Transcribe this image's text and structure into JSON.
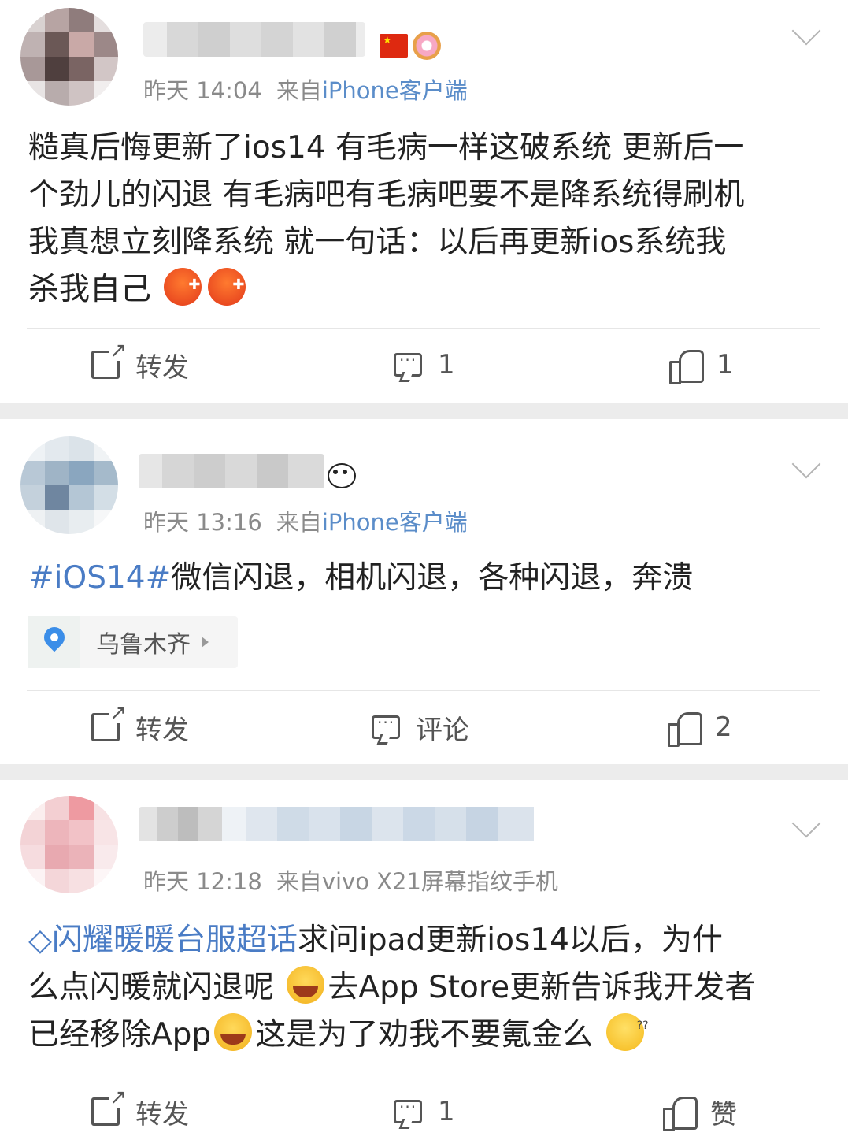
{
  "posts": [
    {
      "time": "昨天 14:04",
      "source_prefix": "来自",
      "device": "iPhone客户端",
      "text_line_1": "糙真后悔更新了ios14 有毛病一样这破系统 更新后一",
      "text_line_2": "个劲儿的闪退 有毛病吧有毛病吧要不是降系统得刷机",
      "text_line_3": "我真想立刻降系统 就一句话：以后再更新ios系统我",
      "text_line_4": "杀我自己",
      "emojis": [
        "angry-face-icon",
        "angry-face-icon"
      ],
      "repost_label": "转发",
      "comment_label": "1",
      "like_label": "1"
    },
    {
      "time": "昨天 13:16",
      "source_prefix": "来自",
      "device": "iPhone客户端",
      "hashtag": "#iOS14#",
      "text": "微信闪退，相机闪退，各种闪退，奔溃",
      "location": "乌鲁木齐",
      "repost_label": "转发",
      "comment_label": "评论",
      "like_label": "2"
    },
    {
      "time": "昨天 12:18",
      "source_prefix": "来自",
      "device": "vivo X21屏幕指纹手机",
      "supertopic": "闪耀暖暖台服超话",
      "text_a": "求问ipad更新ios14以后，为什",
      "text_b": "么点闪暖就闪退呢",
      "text_c": "去App Store更新告诉我开发者",
      "text_d": "已经移除App",
      "text_e": "这是为了劝我不要氪金么",
      "repost_label": "转发",
      "comment_label": "1",
      "like_label": "赞"
    }
  ],
  "colors": {
    "link": "#4a7cc5",
    "meta": "#8a8a8a",
    "separator": "#ececec"
  }
}
